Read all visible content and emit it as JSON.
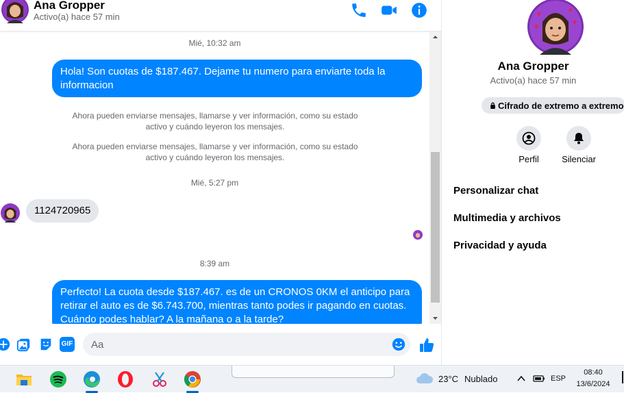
{
  "header": {
    "contact_name": "Ana Gropper",
    "status": "Activo(a) hace 57 min",
    "icons": [
      "phone-icon",
      "video-icon",
      "info-icon"
    ]
  },
  "chat": {
    "timestamps": [
      "Mié, 10:32 am",
      "Mié, 5:27 pm",
      "8:39 am"
    ],
    "messages": [
      {
        "side": "out",
        "text_line1": "Hola! Son cuotas de $187.467. Dejame tu numero para enviarte toda la",
        "text_line2": "informacion"
      },
      {
        "side": "in",
        "text": "1124720965"
      },
      {
        "side": "out",
        "text_line1": "Perfecto! La cuota desde $187.467. es de un CRONOS 0KM el anticipo para",
        "text_line2": "retirar el auto es de $6.743.700, mientras tanto podes ir pagando en cuotas.",
        "text_line3": "Cuándo podes hablar? A la mañana o a la tarde?"
      }
    ],
    "notices": [
      {
        "line1": "Ahora pueden enviarse mensajes, llamarse y ver información, como su estado",
        "line2": "activo y cuándo leyeron los mensajes."
      },
      {
        "line1": "Ahora pueden enviarse mensajes, llamarse y ver información, como su estado",
        "line2": "activo y cuándo leyeron los mensajes."
      }
    ]
  },
  "composer": {
    "placeholder": "Aa",
    "icons": [
      "plus-icon",
      "image-icon",
      "sticker-icon",
      "gif-icon",
      "emoji-icon",
      "like-icon"
    ],
    "gif_label": "GIF"
  },
  "panel": {
    "name": "Ana Gropper",
    "status": "Activo(a) hace 57 min",
    "encryption_label": "Cifrado de extremo a extremo",
    "buttons": [
      {
        "label": "Perfil",
        "icon": "profile-icon"
      },
      {
        "label": "Silenciar",
        "icon": "bell-icon"
      }
    ],
    "menu": [
      "Personalizar chat",
      "Multimedia y archivos",
      "Privacidad y ayuda"
    ]
  },
  "taskbar": {
    "apps": [
      "file-explorer-icon",
      "spotify-icon",
      "edge-icon",
      "opera-icon",
      "snipping-tool-icon",
      "chrome-icon"
    ],
    "weather_temp": "23°C",
    "weather_text": "Nublado",
    "language": "ESP",
    "time": "08:40",
    "date": "13/6/2024"
  },
  "colors": {
    "accent": "#0084ff",
    "incoming_bubble": "#e4e6eb",
    "secondary_text": "#65676b"
  }
}
